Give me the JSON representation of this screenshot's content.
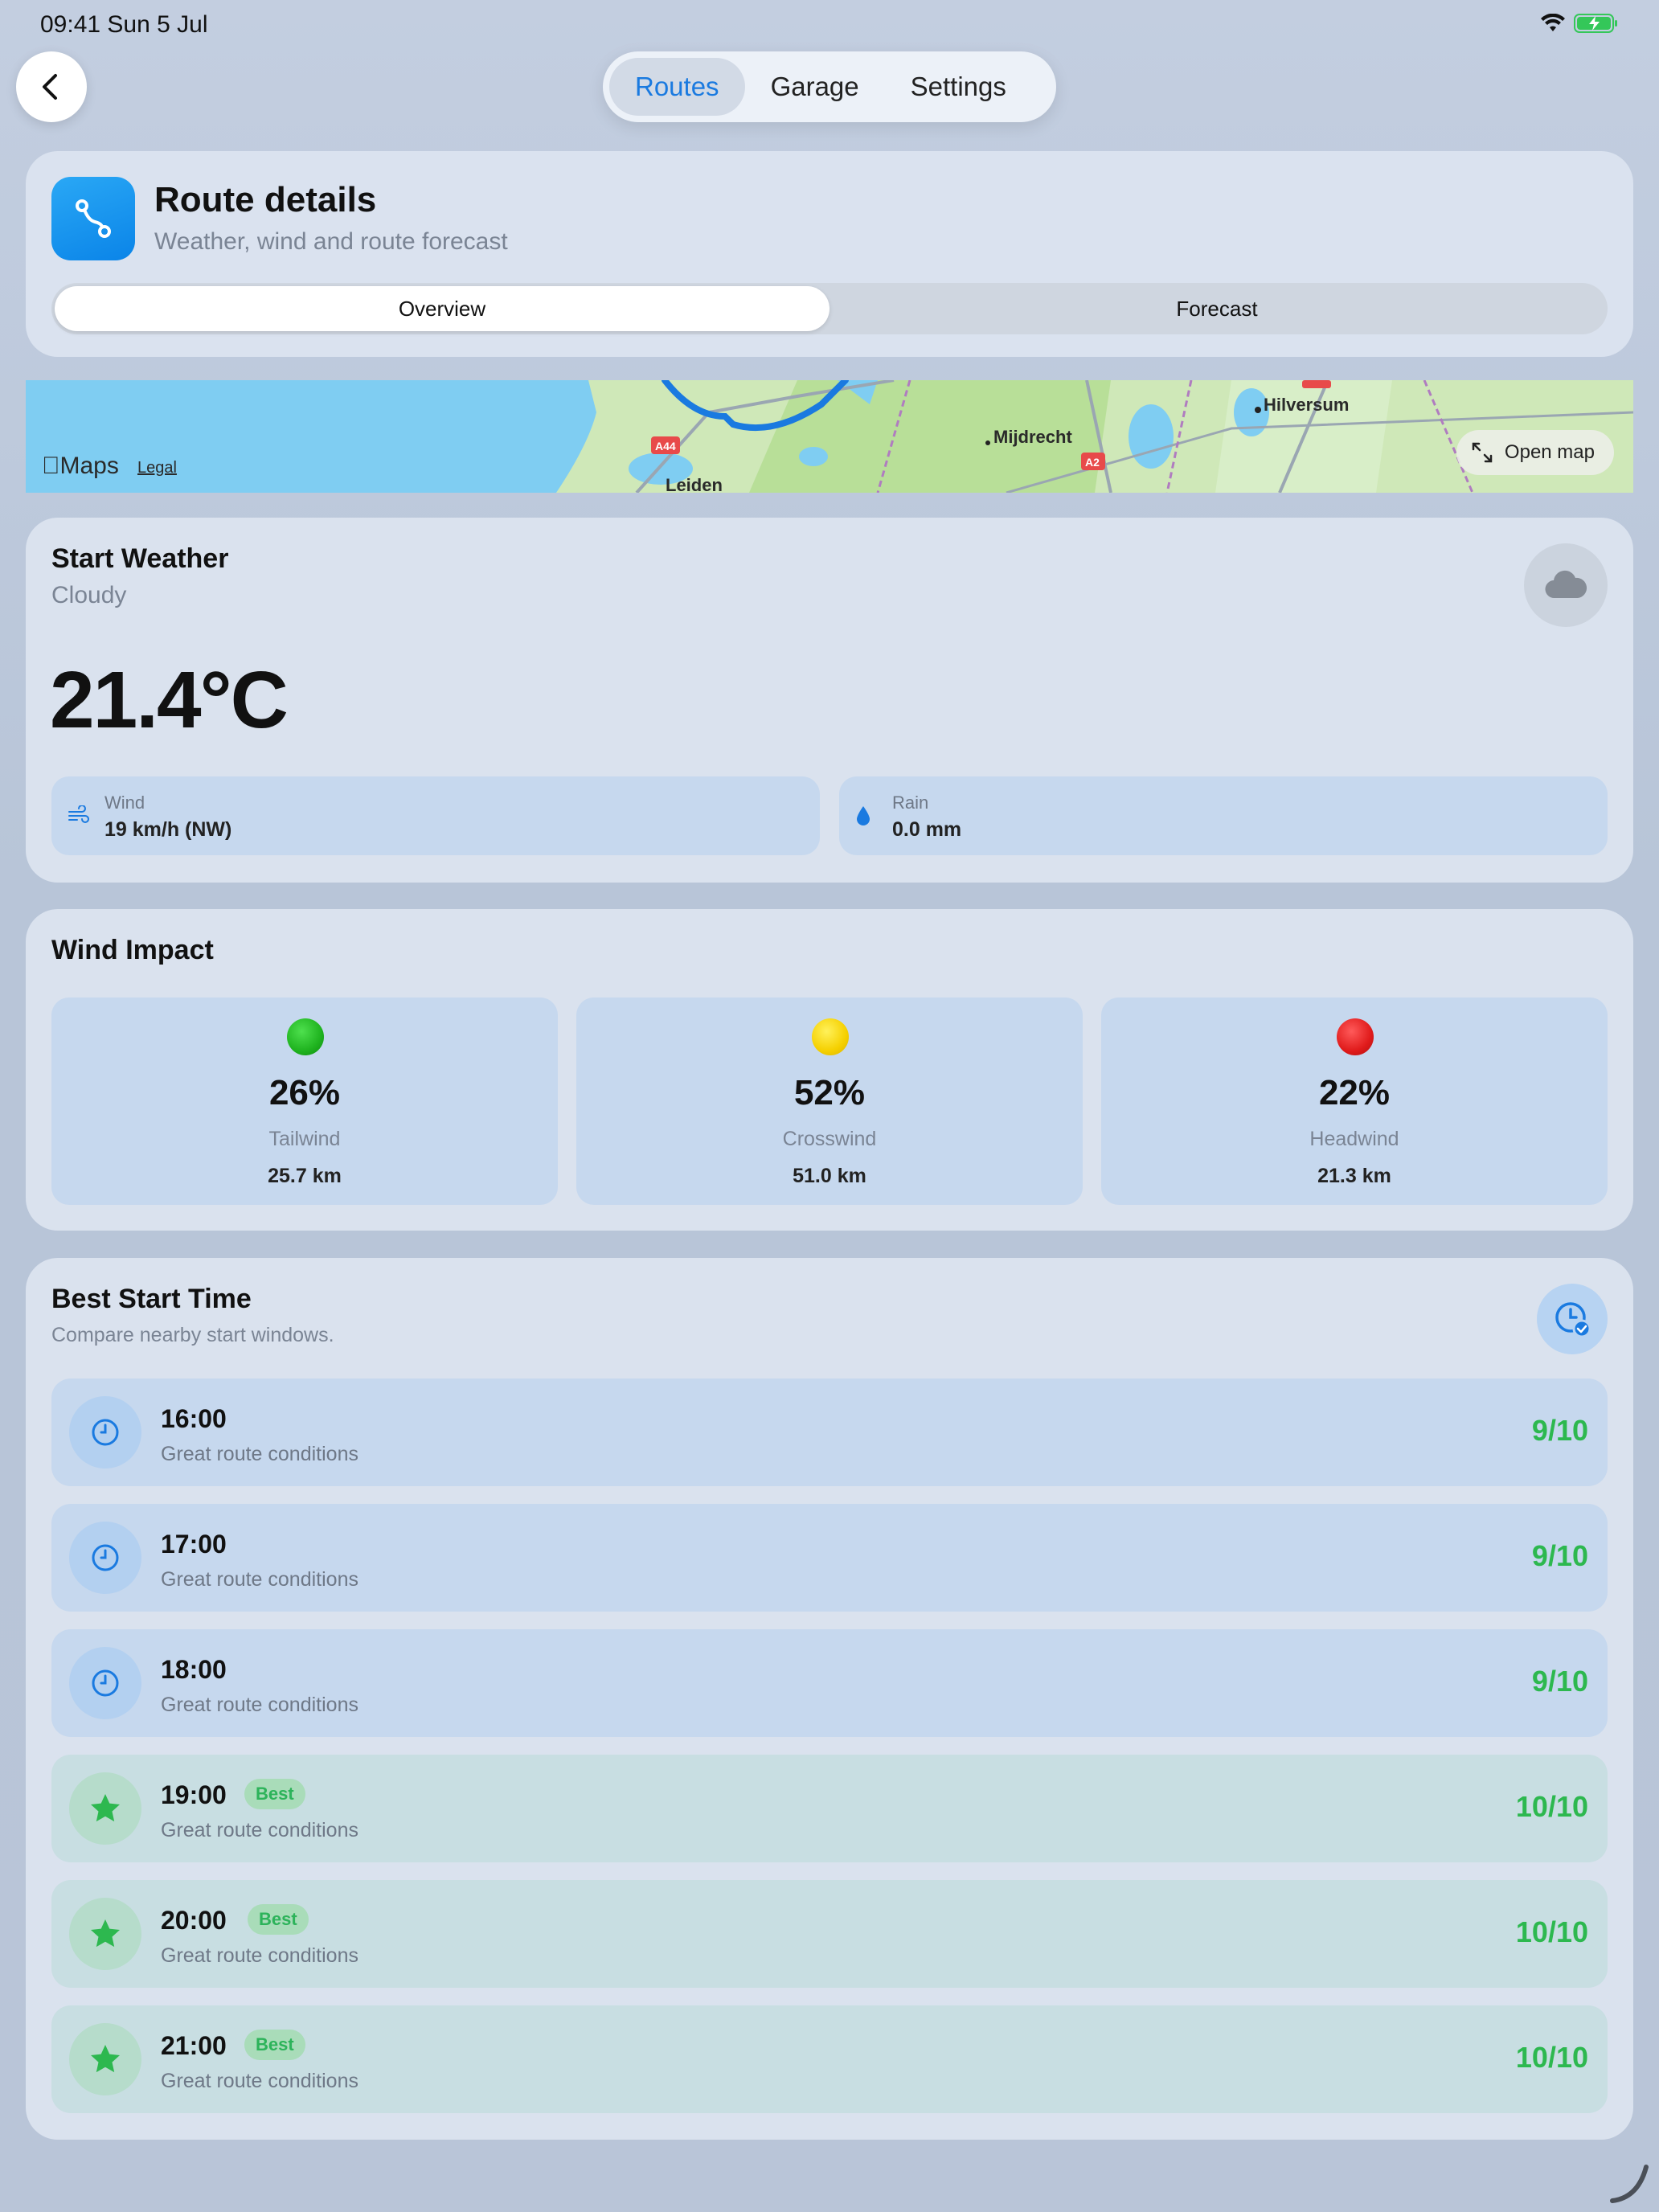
{
  "status": {
    "time": "09:41  Sun 5 Jul"
  },
  "tabs": [
    {
      "label": "Routes"
    },
    {
      "label": "Garage"
    },
    {
      "label": "Settings"
    }
  ],
  "header": {
    "title": "Route details",
    "subtitle": "Weather, wind and route forecast",
    "segments": [
      "Overview",
      "Forecast"
    ]
  },
  "map": {
    "places": [
      "Hilversum",
      "Mijdrecht",
      "Leiden"
    ],
    "road_labels": [
      "A44",
      "A2"
    ],
    "brand": "Maps",
    "legal": "Legal",
    "open_map": "Open map"
  },
  "weather": {
    "title": "Start Weather",
    "condition": "Cloudy",
    "temperature": "21.4°C",
    "wind_label": "Wind",
    "wind_value": "19 km/h (NW)",
    "rain_label": "Rain",
    "rain_value": "0.0 mm"
  },
  "wind_impact": {
    "title": "Wind Impact",
    "items": [
      {
        "percent": "26%",
        "label": "Tailwind",
        "distance": "25.7 km",
        "color": "#1fb31f"
      },
      {
        "percent": "52%",
        "label": "Crosswind",
        "distance": "51.0 km",
        "color": "#f5d000"
      },
      {
        "percent": "22%",
        "label": "Headwind",
        "distance": "21.3 km",
        "color": "#e01b1b"
      }
    ]
  },
  "best_start": {
    "title": "Best Start Time",
    "subtitle": "Compare nearby start windows.",
    "slots": [
      {
        "time": "16:00",
        "desc": "Great route conditions",
        "score": "9/10",
        "badge": ""
      },
      {
        "time": "17:00",
        "desc": "Great route conditions",
        "score": "9/10",
        "badge": ""
      },
      {
        "time": "18:00",
        "desc": "Great route conditions",
        "score": "9/10",
        "badge": ""
      },
      {
        "time": "19:00",
        "desc": "Great route conditions",
        "score": "10/10",
        "badge": "Best"
      },
      {
        "time": "20:00",
        "desc": "Great route conditions",
        "score": "10/10",
        "badge": "Best"
      },
      {
        "time": "21:00",
        "desc": "Great route conditions",
        "score": "10/10",
        "badge": "Best"
      }
    ]
  },
  "colors": {
    "accent": "#1a7ae0",
    "good": "#2db84f"
  }
}
